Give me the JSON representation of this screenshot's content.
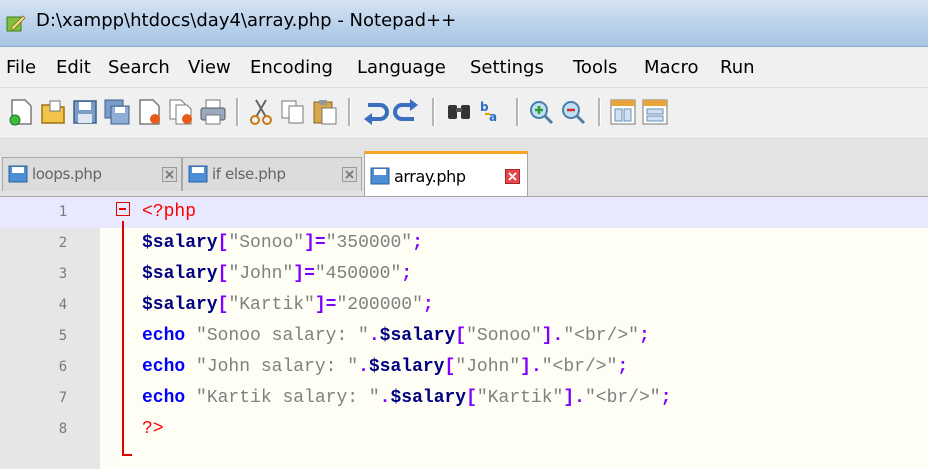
{
  "window": {
    "title": "D:\\xampp\\htdocs\\day4\\array.php - Notepad++"
  },
  "menu": [
    "File",
    "Edit",
    "Search",
    "View",
    "Encoding",
    "Language",
    "Settings",
    "Tools",
    "Macro",
    "Run"
  ],
  "toolbar_icons": [
    "new-file-icon",
    "open-file-icon",
    "save-icon",
    "save-all-icon",
    "close-file-icon",
    "close-all-icon",
    "print-icon",
    "cut-icon",
    "copy-icon",
    "paste-icon",
    "undo-icon",
    "redo-icon",
    "find-icon",
    "replace-icon",
    "zoom-in-icon",
    "zoom-out-icon",
    "sync-vertical-icon",
    "sync-horizontal-icon"
  ],
  "tabs": [
    {
      "label": "loops.php",
      "active": false
    },
    {
      "label": "if else.php",
      "active": false
    },
    {
      "label": "array.php",
      "active": true
    }
  ],
  "editor": {
    "line_numbers": [
      "1",
      "2",
      "3",
      "4",
      "5",
      "6",
      "7",
      "8"
    ],
    "lines": [
      "<?php",
      "$salary[\"Sonoo\"]=\"350000\";",
      "$salary[\"John\"]=\"450000\";",
      "$salary[\"Kartik\"]=\"200000\";",
      "echo \"Sonoo salary: \".$salary[\"Sonoo\"].\"<br/>\";",
      "echo \"John salary: \".$salary[\"John\"].\"<br/>\";",
      "echo \"Kartik salary: \".$salary[\"Kartik\"].\"<br/>\";",
      "?>"
    ]
  },
  "colors": {
    "keyword": "#0000ff",
    "variable": "#000080",
    "string": "#808080",
    "operator": "#8000ff",
    "php_tag": "#ff0000",
    "active_tab_accent": "#f5a623"
  }
}
